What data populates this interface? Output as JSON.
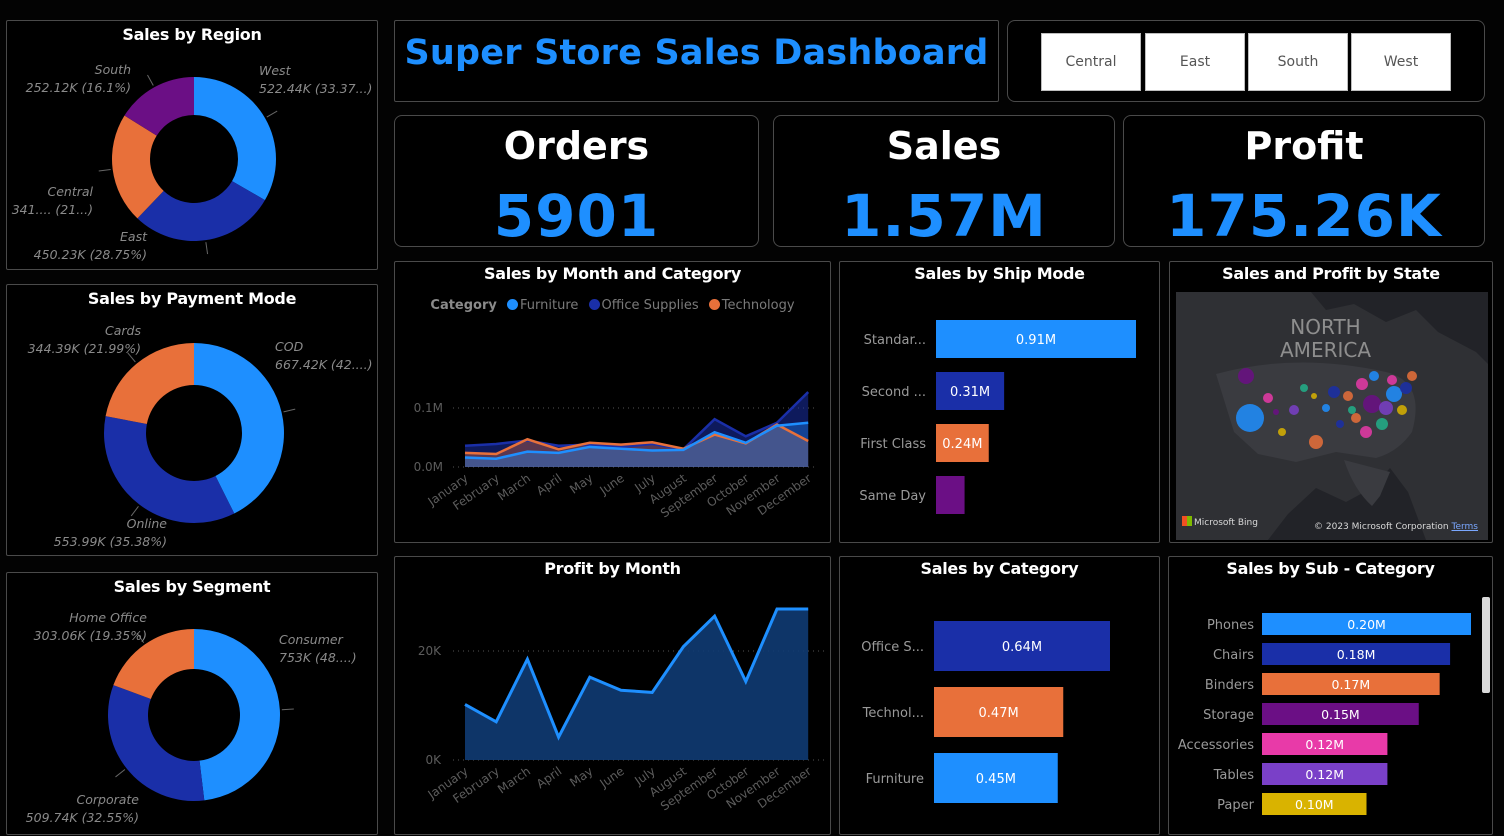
{
  "dashboard_title": "Super Store Sales Dashboard",
  "slicer": {
    "options": [
      "Central",
      "East",
      "South",
      "West"
    ]
  },
  "kpis": [
    {
      "label": "Orders",
      "value": "5901"
    },
    {
      "label": "Sales",
      "value": "1.57M"
    },
    {
      "label": "Profit",
      "value": "175.26K"
    }
  ],
  "colors": {
    "background": "#030303",
    "accent": "#1e8fff",
    "blue": "#1e8fff",
    "navy": "#1a2fa8",
    "orange": "#e8703a",
    "purple": "#6b0f85",
    "magenta": "#e83aa8",
    "violet": "#7a40c8",
    "gold": "#d9b300"
  },
  "map_panel": {
    "title": "Sales and Profit by State",
    "map_label_line1": "NORTH",
    "map_label_line2": "AMERICA",
    "provider": "Microsoft Bing",
    "copyright": "© 2023 Microsoft Corporation",
    "terms": "Terms"
  },
  "chart_data": [
    {
      "id": "region",
      "type": "pie",
      "donut": true,
      "title": "Sales by Region",
      "slices": [
        {
          "label": "West",
          "value": 522.44,
          "display": "522.44K (33.37...)",
          "color": "#1e8fff"
        },
        {
          "label": "East",
          "value": 450.23,
          "display": "450.23K (28.75%)",
          "color": "#1a2fa8"
        },
        {
          "label": "Central",
          "value": 341.0,
          "display": "341.... (21...)",
          "color": "#e8703a"
        },
        {
          "label": "South",
          "value": 252.12,
          "display": "252.12K (16.1%)",
          "color": "#6b0f85"
        }
      ]
    },
    {
      "id": "payment",
      "type": "pie",
      "donut": true,
      "title": "Sales by Payment Mode",
      "slices": [
        {
          "label": "COD",
          "value": 667.42,
          "display": "667.42K (42....)",
          "color": "#1e8fff"
        },
        {
          "label": "Online",
          "value": 553.99,
          "display": "553.99K (35.38%)",
          "color": "#1a2fa8"
        },
        {
          "label": "Cards",
          "value": 344.39,
          "display": "344.39K (21.99%)",
          "color": "#e8703a"
        }
      ]
    },
    {
      "id": "segment",
      "type": "pie",
      "donut": true,
      "title": "Sales by Segment",
      "slices": [
        {
          "label": "Consumer",
          "value": 753.0,
          "display": "753K (48....)",
          "color": "#1e8fff"
        },
        {
          "label": "Corporate",
          "value": 509.74,
          "display": "509.74K (32.55%)",
          "color": "#1a2fa8"
        },
        {
          "label": "Home Office",
          "value": 303.06,
          "display": "303.06K (19.35%)",
          "color": "#e8703a"
        }
      ]
    },
    {
      "id": "month_category",
      "type": "area",
      "title": "Sales by Month and Category",
      "legend_title": "Category",
      "categories": [
        "January",
        "February",
        "March",
        "April",
        "May",
        "June",
        "July",
        "August",
        "September",
        "October",
        "November",
        "December"
      ],
      "y_ticks": [
        "0.0M",
        "0.1M"
      ],
      "ylim": [
        0,
        0.15
      ],
      "series": [
        {
          "name": "Furniture",
          "color": "#1e8fff",
          "values": [
            0.016,
            0.014,
            0.026,
            0.024,
            0.034,
            0.031,
            0.028,
            0.029,
            0.059,
            0.041,
            0.07,
            0.075
          ]
        },
        {
          "name": "Office Supplies",
          "color": "#1a2fa8",
          "values": [
            0.036,
            0.039,
            0.045,
            0.036,
            0.038,
            0.034,
            0.039,
            0.03,
            0.081,
            0.052,
            0.075,
            0.127
          ]
        },
        {
          "name": "Technology",
          "color": "#e8703a",
          "values": [
            0.024,
            0.022,
            0.047,
            0.03,
            0.041,
            0.038,
            0.042,
            0.031,
            0.055,
            0.04,
            0.072,
            0.044
          ]
        }
      ]
    },
    {
      "id": "ship_mode",
      "type": "bar",
      "orientation": "horizontal",
      "title": "Sales by Ship Mode",
      "categories": [
        "Standar...",
        "Second ...",
        "First Class",
        "Same Day"
      ],
      "values": [
        0.91,
        0.31,
        0.24,
        0.13
      ],
      "labels": [
        "0.91M",
        "0.31M",
        "0.24M",
        ""
      ],
      "colors": [
        "#1e8fff",
        "#1a2fa8",
        "#e8703a",
        "#6b0f85"
      ]
    },
    {
      "id": "profit_month",
      "type": "area",
      "title": "Profit by Month",
      "categories": [
        "January",
        "February",
        "March",
        "April",
        "May",
        "June",
        "July",
        "August",
        "September",
        "October",
        "November",
        "December"
      ],
      "y_ticks": [
        "0K",
        "20K"
      ],
      "ylim": [
        0,
        30000
      ],
      "series": [
        {
          "name": "",
          "color": "#1e8fff",
          "values": [
            10200,
            7000,
            18500,
            4200,
            15200,
            12800,
            12400,
            20800,
            26400,
            14400,
            27700,
            null
          ]
        }
      ]
    },
    {
      "id": "category",
      "type": "bar",
      "orientation": "horizontal",
      "title": "Sales by Category",
      "categories": [
        "Office S...",
        "Technol...",
        "Furniture"
      ],
      "values": [
        0.64,
        0.47,
        0.45
      ],
      "labels": [
        "0.64M",
        "0.47M",
        "0.45M"
      ],
      "colors": [
        "#1a2fa8",
        "#e8703a",
        "#1e8fff"
      ]
    },
    {
      "id": "sub_category",
      "type": "bar",
      "orientation": "horizontal",
      "title": "Sales by Sub - Category",
      "categories": [
        "Phones",
        "Chairs",
        "Binders",
        "Storage",
        "Accessories",
        "Tables",
        "Paper"
      ],
      "values": [
        0.2,
        0.18,
        0.17,
        0.15,
        0.12,
        0.12,
        0.1
      ],
      "labels": [
        "0.20M",
        "0.18M",
        "0.17M",
        "0.15M",
        "0.12M",
        "0.12M",
        "0.10M"
      ],
      "colors": [
        "#1e8fff",
        "#1a2fa8",
        "#e8703a",
        "#6b0f85",
        "#e83aa8",
        "#7a40c8",
        "#d9b300"
      ]
    }
  ]
}
